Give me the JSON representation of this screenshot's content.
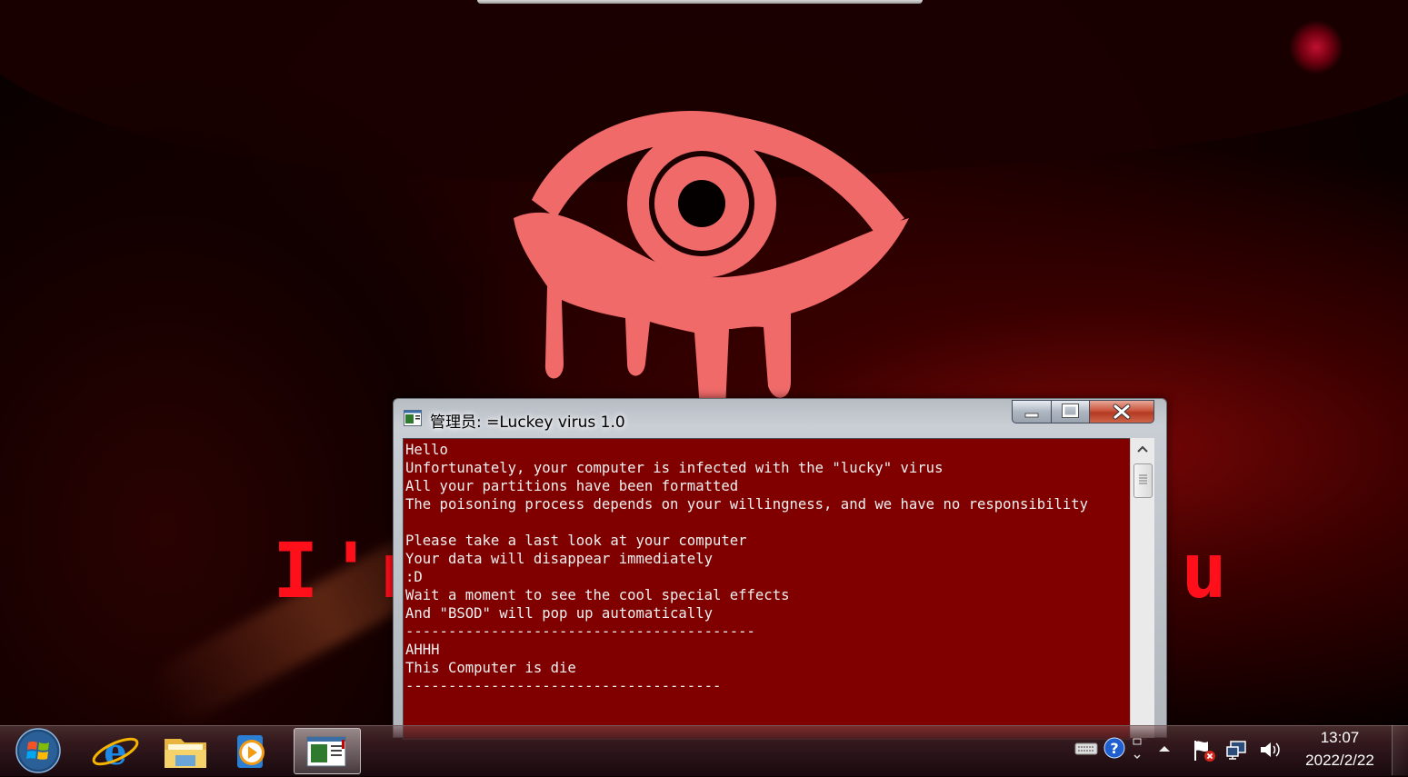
{
  "wallpaper": {
    "banner_left": "I'm",
    "banner_right": "u"
  },
  "console": {
    "title": "管理员: =Luckey virus 1.0",
    "lines": [
      "Hello",
      "Unfortunately, your computer is infected with the \"lucky\" virus",
      "All your partitions have been formatted",
      "The poisoning process depends on your willingness, and we have no responsibility",
      "",
      "Please take a last look at your computer",
      "Your data will disappear immediately",
      ":D",
      "Wait a moment to see the cool special effects",
      "And \"BSOD\" will pop up automatically",
      "-----------------------------------------",
      "AHHH",
      "This Computer is die",
      "-------------------------------------"
    ]
  },
  "taskbar": {
    "apps": [
      "start-icon",
      "internet-explorer-icon",
      "windows-explorer-icon",
      "media-player-icon",
      "console-window-icon"
    ],
    "tray_icons": [
      "keyboard-icon",
      "help-icon",
      "show-hidden-icons-icon",
      "action-center-flag-icon",
      "network-icon",
      "volume-icon"
    ],
    "clock_time": "13:07",
    "clock_date": "2022/2/22"
  },
  "colors": {
    "console_background": "#800000",
    "console_text": "#f0f0f0",
    "eye_logo": "#f06a6a",
    "banner_text": "#ff0f1a"
  }
}
